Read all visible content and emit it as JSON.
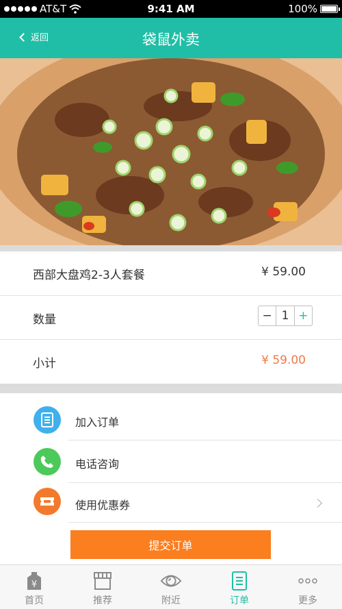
{
  "status_bar": {
    "carrier": "AT&T",
    "time": "9:41 AM",
    "battery": "100%"
  },
  "nav": {
    "back_label": "返回",
    "title": "袋鼠外卖"
  },
  "banner": {
    "image": "dapanji-food-photo",
    "pages": 2,
    "active_page": 1
  },
  "product": {
    "name": "西部大盘鸡2-3人套餐",
    "price": "¥ 59.00"
  },
  "quantity": {
    "label": "数量",
    "minus": "−",
    "value": "1",
    "plus": "+"
  },
  "subtotal": {
    "label": "小计",
    "value": "¥ 59.00"
  },
  "actions": [
    {
      "label": "加入订单",
      "icon": "order-list-icon",
      "color": "#3fb0ec"
    },
    {
      "label": "电话咨询",
      "icon": "phone-icon",
      "color": "#4cc95a"
    },
    {
      "label": "使用优惠券",
      "icon": "coupon-icon",
      "color": "#f37a2c"
    }
  ],
  "submit_label": "提交订单",
  "tabs": [
    {
      "label": "首页",
      "icon": "yen-tag-icon"
    },
    {
      "label": "推荐",
      "icon": "shop-icon"
    },
    {
      "label": "附近",
      "icon": "eye-icon"
    },
    {
      "label": "订单",
      "icon": "order-list-icon",
      "active": true
    },
    {
      "label": "更多",
      "icon": "more-dots-icon"
    }
  ],
  "colors": {
    "brand": "#20bea6",
    "accent_orange": "#fb7e1f",
    "price_orange": "#f07a47"
  }
}
